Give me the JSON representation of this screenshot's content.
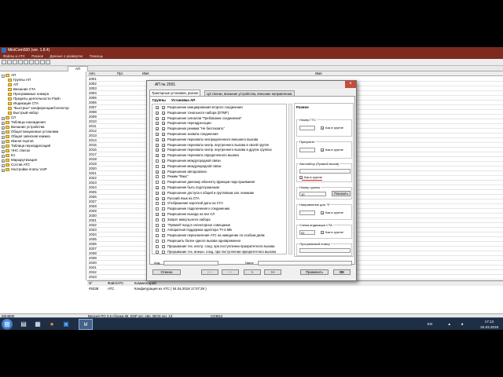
{
  "window": {
    "title": "MiniCom500 (ver. 1.8.4)",
    "menu": [
      "Файлы и АТС",
      "Разное",
      "Данные о развертке",
      "Помощь"
    ]
  },
  "tab": {
    "label": "АП"
  },
  "tree": [
    {
      "label": "АП",
      "level": 0,
      "expander": "-"
    },
    {
      "label": "Группы АП",
      "level": 1
    },
    {
      "label": "АП",
      "level": 1
    },
    {
      "label": "Внешние СТА",
      "level": 1
    },
    {
      "label": "Программные номера",
      "level": 1
    },
    {
      "label": "Пределы деятельности Flash",
      "level": 1
    },
    {
      "label": "Индикация СТА",
      "level": 1
    },
    {
      "label": "\"Быстрые\" конференции/Селектор",
      "level": 1
    },
    {
      "label": "Быстрый набор",
      "level": 1
    },
    {
      "label": "СЛ",
      "level": 0,
      "expander": "+"
    },
    {
      "label": "Таблицы нахождения",
      "level": 0,
      "expander": "+"
    },
    {
      "label": "Внешние устройства",
      "level": 0,
      "expander": "+"
    },
    {
      "label": "Общестанционные установки",
      "level": 0,
      "expander": "+"
    },
    {
      "label": "Общая записная книжка",
      "level": 0,
      "expander": "+"
    },
    {
      "label": "Именя портов",
      "level": 0,
      "expander": "+"
    },
    {
      "label": "Таблица переадресаций",
      "level": 0,
      "expander": "+"
    },
    {
      "label": "ЧНС список",
      "level": 0,
      "expander": "+"
    },
    {
      "label": "E1",
      "level": 0,
      "expander": "+"
    },
    {
      "label": "Маршрутизация",
      "level": 0,
      "expander": "+"
    },
    {
      "label": "Состав АТС",
      "level": 0,
      "expander": "+"
    },
    {
      "label": "Настройки платы VoIP",
      "level": 0,
      "expander": "+"
    }
  ],
  "grid": {
    "columns": [
      "Апп.",
      "Прг.",
      "Имя",
      "Имя"
    ],
    "rows": [
      "2001",
      "2002",
      "2003",
      "2004",
      "2005",
      "2006",
      "2007",
      "2008",
      "2009",
      "2010",
      "2011",
      "2012",
      "2013",
      "2014",
      "2015",
      "2016",
      "2017",
      "2018",
      "2019",
      "2020",
      "2021",
      "2022",
      "2023",
      "2024",
      "2025",
      "2026",
      "2027",
      "2028",
      "2029",
      "2030",
      "2031",
      "2032",
      "2033",
      "2034",
      "2035",
      "2036",
      "2037",
      "2038",
      "2039",
      "2040",
      "2041",
      "2042",
      "2043",
      "2044"
    ]
  },
  "bottom": {
    "columns": [
      "N°",
      "Файл/АТС",
      "Комментарий"
    ],
    "row": [
      "#5338",
      "АТС",
      "Конфигурация из АТС ( 04.04.2018 17:07:29 )"
    ]
  },
  "status": {
    "left": "MX4500",
    "version": "Версия ПО 2.5 сборка 56, DSP ver. A8е, BIOS ver. 13",
    "port": "COM12"
  },
  "dialog": {
    "title": "АП № 2001",
    "tabs": [
      "Трактерные установки, разное",
      "ЦЗ списки, внешние устройства, внешние направления,"
    ],
    "col_groups": "Группы",
    "col_settings": "Установка АП",
    "permissions": [
      {
        "label": "Разрешение инициирования второго соединения",
        "g": true,
        "u": true
      },
      {
        "label": "Разрешение тонального набора (DTMF)",
        "g": true,
        "u": true
      },
      {
        "label": "Разрешение сигналов \"Требование соединения\"",
        "g": true,
        "u": true
      },
      {
        "label": "Разрешение переадресации",
        "g": true,
        "u": true
      },
      {
        "label": "Разрешение режима \"Не беспокоить\"",
        "g": true,
        "u": true
      },
      {
        "label": "Разрешение захвата соединения",
        "g": true,
        "u": true
      },
      {
        "label": "Разрешение перехвата неопределенного внешнего вызова",
        "g": true,
        "u": true
      },
      {
        "label": "Разрешение перехвата неопр. внутреннего вызова в своей группе",
        "g": true,
        "u": true
      },
      {
        "label": "Разрешение перехвата неопр. внутреннего вызова в других группах",
        "g": true,
        "u": true
      },
      {
        "label": "Разрешение перехвата определенного вызова",
        "g": true,
        "u": true
      },
      {
        "label": "Разрешение междугородной связи",
        "g": false,
        "u": true
      },
      {
        "label": "Разрешение международной связи",
        "g": false,
        "u": true
      },
      {
        "label": "Разрешение автодозвона",
        "g": true,
        "u": true
      },
      {
        "label": "Режим \"Факс\"",
        "g": false,
        "u": false
      },
      {
        "label": "Разрешение данному абоненту функции подслушивания",
        "g": false,
        "u": false
      },
      {
        "label": "Разрешение быть подслушанным",
        "g": true,
        "u": false
      },
      {
        "label": "Разрешение доступа к общей и групповым зап. книжкам",
        "g": true,
        "u": true
      },
      {
        "label": "Русский язык на СТА",
        "g": true,
        "u": true
      },
      {
        "label": "Отображение короткой даты на СТА",
        "g": false,
        "u": false
      },
      {
        "label": "Разрешение подключения к соединению",
        "g": false,
        "u": false
      },
      {
        "label": "Разрешение выхода на все СЛ",
        "g": true,
        "u": true
      },
      {
        "label": "Запрет импульсного набора",
        "g": false,
        "u": false
      },
      {
        "label": "\"Прямой\" вход в селекторное совещание",
        "g": false,
        "u": false
      },
      {
        "label": "Аппаратная поддержка адаптера ТЧ в МБ",
        "g": false,
        "u": false
      },
      {
        "label": "Разрешение переключения АТС на наведение по особым дням",
        "g": false,
        "u": false
      },
      {
        "label": "Разрешить более одного вызова одновременно",
        "g": false,
        "u": false
      },
      {
        "label": "Прерывание тех. инстр. соед. при поступлении приоритетного вызова",
        "g": false,
        "u": false
      },
      {
        "label": "Прерывание тех. внешн. соед. при поступлении приоритетного вызова",
        "g": false,
        "u": false
      }
    ],
    "right": {
      "title": "Разное",
      "gts": {
        "label": "Номер ГТС",
        "check": "Как в группе"
      },
      "priority": {
        "label": "Приоритет",
        "check": "Как в группе"
      },
      "autocall": {
        "label": "Автонабор (Прямой вызов)",
        "check": "Как в группе"
      },
      "group": {
        "label": "Номер группы",
        "value": "10",
        "button": "Показать"
      },
      "direction": {
        "label": "Направление для \"9\"",
        "check": "Как в группе"
      },
      "indication": {
        "label": "Схема индикации СТА",
        "value": "01",
        "check": "Как в группе"
      },
      "prognum": {
        "label": "Программный номер"
      }
    },
    "addr": {
      "label": "Анд.",
      "name": "Name"
    },
    "buttons": {
      "cancel": "Отмена",
      "first": "|<<",
      "prev": "<<",
      "next": ">",
      "last": ">>",
      "apply": "Применить",
      "ok": "OK"
    }
  },
  "tray": {
    "lang": "EN",
    "time": "17:13",
    "date": "04.04.2018"
  }
}
